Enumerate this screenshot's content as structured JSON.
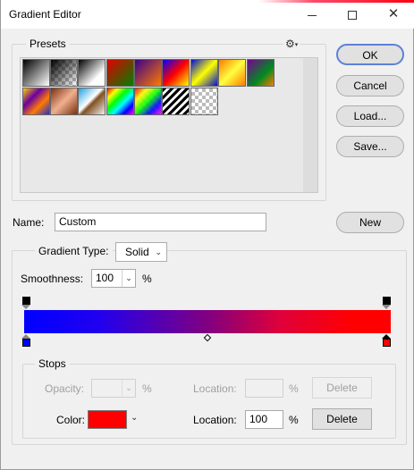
{
  "window": {
    "title": "Gradient Editor"
  },
  "presets": {
    "label": "Presets",
    "swatches": [
      "foreground-to-background",
      "foreground-to-transparent",
      "black-white",
      "red-green",
      "violet-orange",
      "blue-red-yellow",
      "blue-yellow-blue",
      "orange-yellow-orange",
      "violet-green-orange",
      "yellow-violet-orange-blue",
      "copper",
      "chrome",
      "spectrum",
      "transparent-rainbow",
      "transparent-stripes",
      "transparent"
    ]
  },
  "buttons": {
    "ok": "OK",
    "cancel": "Cancel",
    "load": "Load...",
    "save": "Save...",
    "new": "New"
  },
  "name": {
    "label": "Name:",
    "value": "Custom"
  },
  "gradient": {
    "type_label": "Gradient Type:",
    "type_value": "Solid",
    "smoothness_label": "Smoothness:",
    "smoothness_value": "100",
    "smoothness_unit": "%",
    "start_color": "#0000ff",
    "end_color": "#ff0000"
  },
  "stops": {
    "label": "Stops",
    "opacity_label": "Opacity:",
    "opacity_value": "",
    "opacity_unit": "%",
    "opacity_location_label": "Location:",
    "opacity_location_value": "",
    "opacity_location_unit": "%",
    "opacity_delete": "Delete",
    "color_label": "Color:",
    "color_value": "#ff0000",
    "color_location_label": "Location:",
    "color_location_value": "100",
    "color_location_unit": "%",
    "color_delete": "Delete"
  }
}
